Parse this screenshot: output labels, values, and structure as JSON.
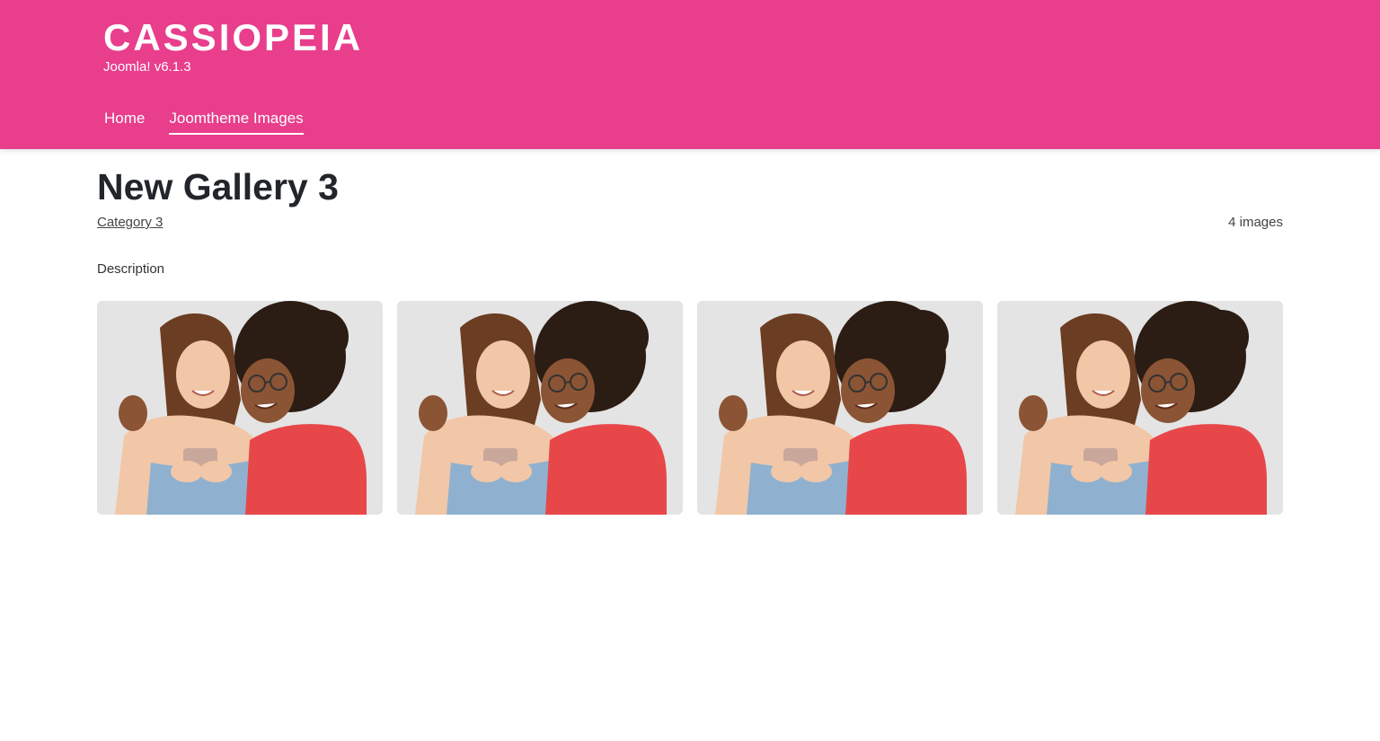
{
  "header": {
    "brand_name": "CASSIOPEIA",
    "brand_description": "Joomla! v6.1.3",
    "background_color": "#e83e8c",
    "nav": [
      {
        "label": "Home",
        "active": false
      },
      {
        "label": "Joomtheme Images",
        "active": true
      }
    ]
  },
  "gallery_page": {
    "title": "New Gallery 3",
    "category_link": "Category 3",
    "image_count": "4 images",
    "description": "Description",
    "images": [
      {
        "subject": "two-women-looking-at-phone-photo"
      },
      {
        "subject": "two-women-looking-at-phone-photo"
      },
      {
        "subject": "two-women-looking-at-phone-photo"
      },
      {
        "subject": "two-women-looking-at-phone-photo"
      }
    ]
  }
}
